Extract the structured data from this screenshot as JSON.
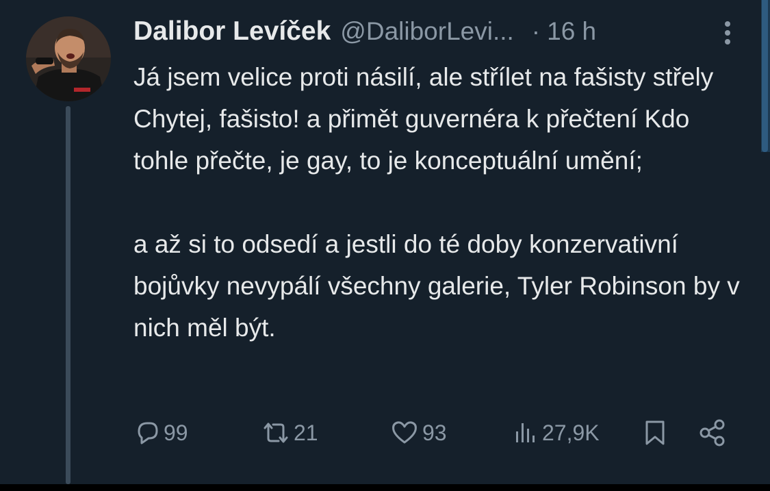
{
  "tweet": {
    "display_name": "Dalibor Levíček",
    "handle": "@DaliborLevi...",
    "separator": "·",
    "time": "16 h",
    "paragraphs": [
      "Já jsem velice proti násilí, ale střílet na fašisty střely Chytej, fašisto! a přimět guvernéra k přečtení Kdo tohle přečte, je gay, to je konceptuální umění;",
      "a až si to odsedí a jestli do té doby konzervativní bojůvky nevypálí všechny galerie, Tyler Robinson by v nich měl být."
    ],
    "actions": {
      "replies": "99",
      "retweets": "21",
      "likes": "93",
      "views": "27,9K"
    }
  },
  "colors": {
    "background": "#15202b",
    "text_primary": "#e7e9ea",
    "text_secondary": "#8b98a5",
    "thread_line": "#3b4b5a"
  },
  "icons": {
    "more": "more-vertical-icon",
    "reply": "reply-bubble-icon",
    "retweet": "retweet-icon",
    "like": "heart-icon",
    "views": "views-bar-chart-icon",
    "bookmark": "bookmark-icon",
    "share": "share-icon"
  }
}
